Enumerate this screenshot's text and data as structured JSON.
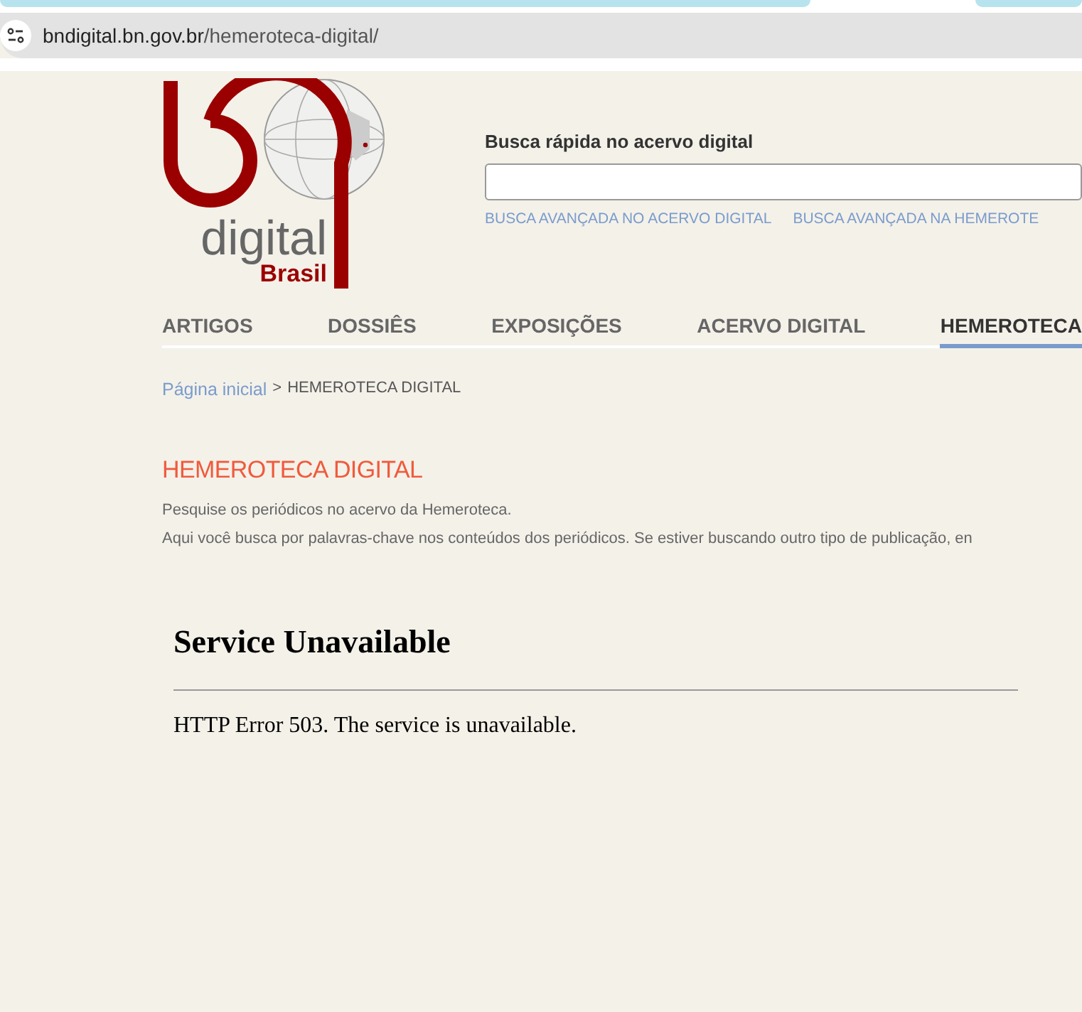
{
  "browser": {
    "url_host": "bndigital.bn.gov.br",
    "url_path": "/hemeroteca-digital/"
  },
  "logo": {
    "word": "digital",
    "country": "Brasil"
  },
  "search": {
    "label": "Busca rápida no acervo digital",
    "links": [
      "BUSCA AVANÇADA NO ACERVO DIGITAL",
      "BUSCA AVANÇADA NA HEMEROTE"
    ]
  },
  "nav": [
    {
      "label": "ARTIGOS",
      "selected": false
    },
    {
      "label": "DOSSIÊS",
      "selected": false
    },
    {
      "label": "EXPOSIÇÕES",
      "selected": false
    },
    {
      "label": "ACERVO DIGITAL",
      "selected": false
    },
    {
      "label": "HEMEROTECA",
      "selected": true
    }
  ],
  "breadcrumb": {
    "home": "Página inicial",
    "separator": ">",
    "current": "HEMEROTECA DIGITAL"
  },
  "page": {
    "title": "HEMEROTECA DIGITAL",
    "lines": [
      "Pesquise os periódicos no acervo da Hemeroteca.",
      "Aqui você busca por palavras-chave nos conteúdos dos periódicos. Se estiver buscando outro tipo de publicação, en"
    ]
  },
  "error": {
    "title": "Service Unavailable",
    "message": "HTTP Error 503. The service is unavailable."
  }
}
